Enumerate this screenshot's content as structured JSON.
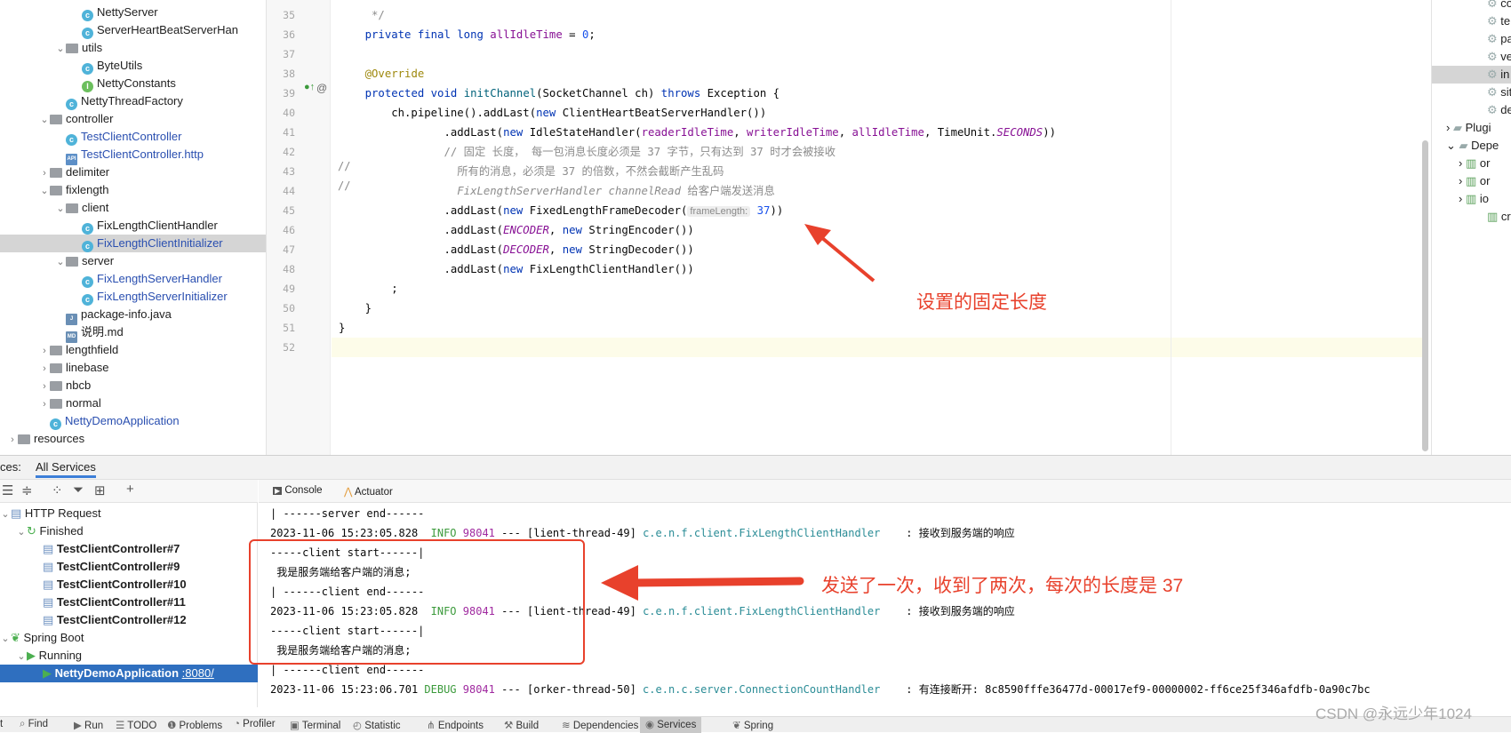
{
  "project_tree": [
    {
      "indent": 5,
      "chev": "",
      "icon": "c",
      "label": "NettyServer"
    },
    {
      "indent": 5,
      "chev": "",
      "icon": "c",
      "label": "ServerHeartBeatServerHan"
    },
    {
      "indent": 4,
      "chev": "v",
      "icon": "f",
      "label": "utils"
    },
    {
      "indent": 5,
      "chev": "",
      "icon": "c",
      "label": "ByteUtils"
    },
    {
      "indent": 5,
      "chev": "",
      "icon": "i",
      "label": "NettyConstants"
    },
    {
      "indent": 4,
      "chev": "",
      "icon": "c",
      "label": "NettyThreadFactory"
    },
    {
      "indent": 3,
      "chev": "v",
      "icon": "f",
      "label": "controller"
    },
    {
      "indent": 4,
      "chev": "",
      "icon": "c",
      "label": "TestClientController",
      "blue": true
    },
    {
      "indent": 4,
      "chev": "",
      "icon": "api",
      "label": "TestClientController.http",
      "blue": true
    },
    {
      "indent": 3,
      "chev": ">",
      "icon": "f",
      "label": "delimiter"
    },
    {
      "indent": 3,
      "chev": "v",
      "icon": "f",
      "label": "fixlength"
    },
    {
      "indent": 4,
      "chev": "v",
      "icon": "f",
      "label": "client"
    },
    {
      "indent": 5,
      "chev": "",
      "icon": "c",
      "label": "FixLengthClientHandler"
    },
    {
      "indent": 5,
      "chev": "",
      "icon": "c",
      "label": "FixLengthClientInitializer",
      "blue": true,
      "selected": true
    },
    {
      "indent": 4,
      "chev": "v",
      "icon": "f",
      "label": "server"
    },
    {
      "indent": 5,
      "chev": "",
      "icon": "c",
      "label": "FixLengthServerHandler",
      "blue": true
    },
    {
      "indent": 5,
      "chev": "",
      "icon": "c",
      "label": "FixLengthServerInitializer",
      "blue": true
    },
    {
      "indent": 4,
      "chev": "",
      "icon": "j",
      "label": "package-info.java"
    },
    {
      "indent": 4,
      "chev": "",
      "icon": "md",
      "label": "说明.md"
    },
    {
      "indent": 3,
      "chev": ">",
      "icon": "f",
      "label": "lengthfield"
    },
    {
      "indent": 3,
      "chev": ">",
      "icon": "f",
      "label": "linebase"
    },
    {
      "indent": 3,
      "chev": ">",
      "icon": "f",
      "label": "nbcb"
    },
    {
      "indent": 3,
      "chev": ">",
      "icon": "f",
      "label": "normal"
    },
    {
      "indent": 3,
      "chev": "",
      "icon": "c",
      "label": "NettyDemoApplication",
      "blue": true
    },
    {
      "indent": 1,
      "chev": ">",
      "icon": "f",
      "label": "resources"
    }
  ],
  "editor": {
    "line_numbers": [
      "35",
      "36",
      "37",
      "38",
      "39",
      "40",
      "41",
      "42",
      "43",
      "44",
      "45",
      "46",
      "47",
      "48",
      "49",
      "50",
      "51",
      "52"
    ],
    "lines": [
      [
        [
          "     */",
          "cm"
        ]
      ],
      [
        [
          "    ",
          "plain"
        ],
        [
          "private final long ",
          "kw"
        ],
        [
          "allIdleTime",
          "field"
        ],
        [
          " = ",
          "plain"
        ],
        [
          "0",
          "num"
        ],
        [
          ";",
          "plain"
        ]
      ],
      [],
      [
        [
          "    ",
          "plain"
        ],
        [
          "@Override",
          "ann"
        ]
      ],
      [
        [
          "    ",
          "plain"
        ],
        [
          "protected void ",
          "kw"
        ],
        [
          "initChannel",
          "fn"
        ],
        [
          "(SocketChannel ch) ",
          "plain"
        ],
        [
          "throws ",
          "kw"
        ],
        [
          "Exception {",
          "plain"
        ]
      ],
      [
        [
          "        ch.pipeline().addLast(",
          "plain"
        ],
        [
          "new ",
          "kw"
        ],
        [
          "ClientHeartBeatServerHandler())",
          "plain"
        ]
      ],
      [
        [
          "                .addLast(",
          "plain"
        ],
        [
          "new ",
          "kw"
        ],
        [
          "IdleStateHandler(",
          "plain"
        ],
        [
          "readerIdleTime",
          "field"
        ],
        [
          ", ",
          "plain"
        ],
        [
          "writerIdleTime",
          "field"
        ],
        [
          ", ",
          "plain"
        ],
        [
          "allIdleTime",
          "field"
        ],
        [
          ", TimeUnit.",
          "plain"
        ],
        [
          "SECONDS",
          "const"
        ],
        [
          "))",
          "plain"
        ]
      ],
      [
        [
          "                // 固定 长度， 每一包消息长度必须是 37 字节，只有达到 37 时才会被接收",
          "cm"
        ]
      ],
      [
        [
          "                  所有的消息，必须是 37 的倍数，不然会截断产生乱码",
          "cm"
        ]
      ],
      [
        [
          "                  FixLengthServerHandler channelRead ",
          "cmi"
        ],
        [
          "给客户端发送消息",
          "cm"
        ]
      ],
      [
        [
          "                .addLast(",
          "plain"
        ],
        [
          "new ",
          "kw"
        ],
        [
          "FixedLengthFrameDecoder(",
          "plain"
        ],
        [
          "frameLength:",
          "hint"
        ],
        [
          " 37",
          "num"
        ],
        [
          "))",
          "plain"
        ]
      ],
      [
        [
          "                .addLast(",
          "plain"
        ],
        [
          "ENCODER",
          "const"
        ],
        [
          ", ",
          "plain"
        ],
        [
          "new ",
          "kw"
        ],
        [
          "StringEncoder())",
          "plain"
        ]
      ],
      [
        [
          "                .addLast(",
          "plain"
        ],
        [
          "DECODER",
          "const"
        ],
        [
          ", ",
          "plain"
        ],
        [
          "new ",
          "kw"
        ],
        [
          "StringDecoder())",
          "plain"
        ]
      ],
      [
        [
          "                .addLast(",
          "plain"
        ],
        [
          "new ",
          "kw"
        ],
        [
          "FixLengthClientHandler())",
          "plain"
        ]
      ],
      [
        [
          "        ;",
          "plain"
        ]
      ],
      [
        [
          "    }",
          "plain"
        ]
      ],
      [
        [
          "}",
          "plain"
        ]
      ],
      []
    ],
    "comment_markers": [
      "//",
      "//"
    ]
  },
  "right_panel": [
    {
      "label": "co",
      "icon": "gear"
    },
    {
      "label": "te",
      "icon": "gear"
    },
    {
      "label": "pa",
      "icon": "gear"
    },
    {
      "label": "ve",
      "icon": "gear"
    },
    {
      "label": "in",
      "icon": "gear",
      "selected": true
    },
    {
      "label": "sit",
      "icon": "gear"
    },
    {
      "label": "de",
      "icon": "gear"
    },
    {
      "label": "Plugi",
      "icon": "folder",
      "chev": ">"
    },
    {
      "label": "Depe",
      "icon": "folder",
      "chev": "v"
    },
    {
      "label": "or",
      "icon": "lib",
      "chev": ">"
    },
    {
      "label": "or",
      "icon": "lib",
      "chev": ">"
    },
    {
      "label": "io",
      "icon": "lib",
      "chev": ">"
    },
    {
      "label": "cr",
      "icon": "lib",
      "chev": ""
    }
  ],
  "services": {
    "tab_prefix": "ces:",
    "tab_active": "All Services",
    "tree": [
      {
        "indent": 0,
        "chev": "v",
        "icon": "api",
        "label": "HTTP Request"
      },
      {
        "indent": 1,
        "chev": "v",
        "icon": "refresh",
        "label": "Finished"
      },
      {
        "indent": 2,
        "chev": "",
        "icon": "api",
        "label": "TestClientController#7",
        "bold": true
      },
      {
        "indent": 2,
        "chev": "",
        "icon": "api",
        "label": "TestClientController#9",
        "bold": true
      },
      {
        "indent": 2,
        "chev": "",
        "icon": "api",
        "label": "TestClientController#10",
        "bold": true
      },
      {
        "indent": 2,
        "chev": "",
        "icon": "api",
        "label": "TestClientController#11",
        "bold": true
      },
      {
        "indent": 2,
        "chev": "",
        "icon": "api",
        "label": "TestClientController#12",
        "bold": true
      },
      {
        "indent": 0,
        "chev": "v",
        "icon": "spring",
        "label": "Spring Boot"
      },
      {
        "indent": 1,
        "chev": "v",
        "icon": "run",
        "label": "Running"
      },
      {
        "indent": 2,
        "chev": "",
        "icon": "run",
        "label": "NettyDemoApplication",
        "link": ":8080/",
        "bold": true,
        "selected": true
      }
    ],
    "console_tabs": [
      "Console",
      "Actuator"
    ],
    "console": [
      [
        [
          "| ------server end------",
          "plain"
        ]
      ],
      [
        [
          "2023-11-06 15:23:05.828  ",
          "plain"
        ],
        [
          "INFO",
          "c-info"
        ],
        [
          " ",
          "plain"
        ],
        [
          "98041",
          "c-pid"
        ],
        [
          " --- [lient-thread-49] ",
          "plain"
        ],
        [
          "c.e.n.f.client.FixLengthClientHandler",
          "c-cls"
        ],
        [
          "    : 接收到服务端的响应",
          "plain"
        ]
      ],
      [
        [
          "-----client start------|",
          "plain"
        ]
      ],
      [
        [
          " 我是服务端给客户端的消息;",
          "plain"
        ]
      ],
      [
        [
          "| ------client end------",
          "plain"
        ]
      ],
      [
        [
          "2023-11-06 15:23:05.828  ",
          "plain"
        ],
        [
          "INFO",
          "c-info"
        ],
        [
          " ",
          "plain"
        ],
        [
          "98041",
          "c-pid"
        ],
        [
          " --- [lient-thread-49] ",
          "plain"
        ],
        [
          "c.e.n.f.client.FixLengthClientHandler",
          "c-cls"
        ],
        [
          "    : 接收到服务端的响应",
          "plain"
        ]
      ],
      [
        [
          "-----client start------|",
          "plain"
        ]
      ],
      [
        [
          " 我是服务端给客户端的消息;",
          "plain"
        ]
      ],
      [
        [
          "| ------client end------",
          "plain"
        ]
      ],
      [
        [
          "2023-11-06 15:23:06.701 ",
          "plain"
        ],
        [
          "DEBUG",
          "c-debug"
        ],
        [
          " ",
          "plain"
        ],
        [
          "98041",
          "c-pid"
        ],
        [
          " --- [orker-thread-50] ",
          "plain"
        ],
        [
          "c.e.n.c.server.ConnectionCountHandler",
          "c-cls"
        ],
        [
          "    : 有连接断开: 8c8590fffe36477d-00017ef9-00000002-ff6ce25f346afdfb-0a90c7bc",
          "plain"
        ]
      ]
    ]
  },
  "status_bar": [
    {
      "icon": "",
      "label": "t"
    },
    {
      "icon": "⌕",
      "label": "Find"
    },
    {
      "icon": "▶",
      "label": "Run"
    },
    {
      "icon": "☰",
      "label": "TODO"
    },
    {
      "icon": "❶",
      "label": "Problems"
    },
    {
      "icon": "◔",
      "label": "Profiler"
    },
    {
      "icon": "▣",
      "label": "Terminal"
    },
    {
      "icon": "◴",
      "label": "Statistic"
    },
    {
      "icon": "⋔",
      "label": "Endpoints"
    },
    {
      "icon": "⚒",
      "label": "Build"
    },
    {
      "icon": "≋",
      "label": "Dependencies"
    },
    {
      "icon": "◉",
      "label": "Services",
      "active": true
    },
    {
      "icon": "❦",
      "label": "Spring"
    }
  ],
  "annotations": {
    "note1": "设置的固定长度",
    "note2": "发送了一次，收到了两次，每次的长度是 37",
    "color": "#e8412c"
  },
  "watermark": "CSDN @永远少年1024"
}
